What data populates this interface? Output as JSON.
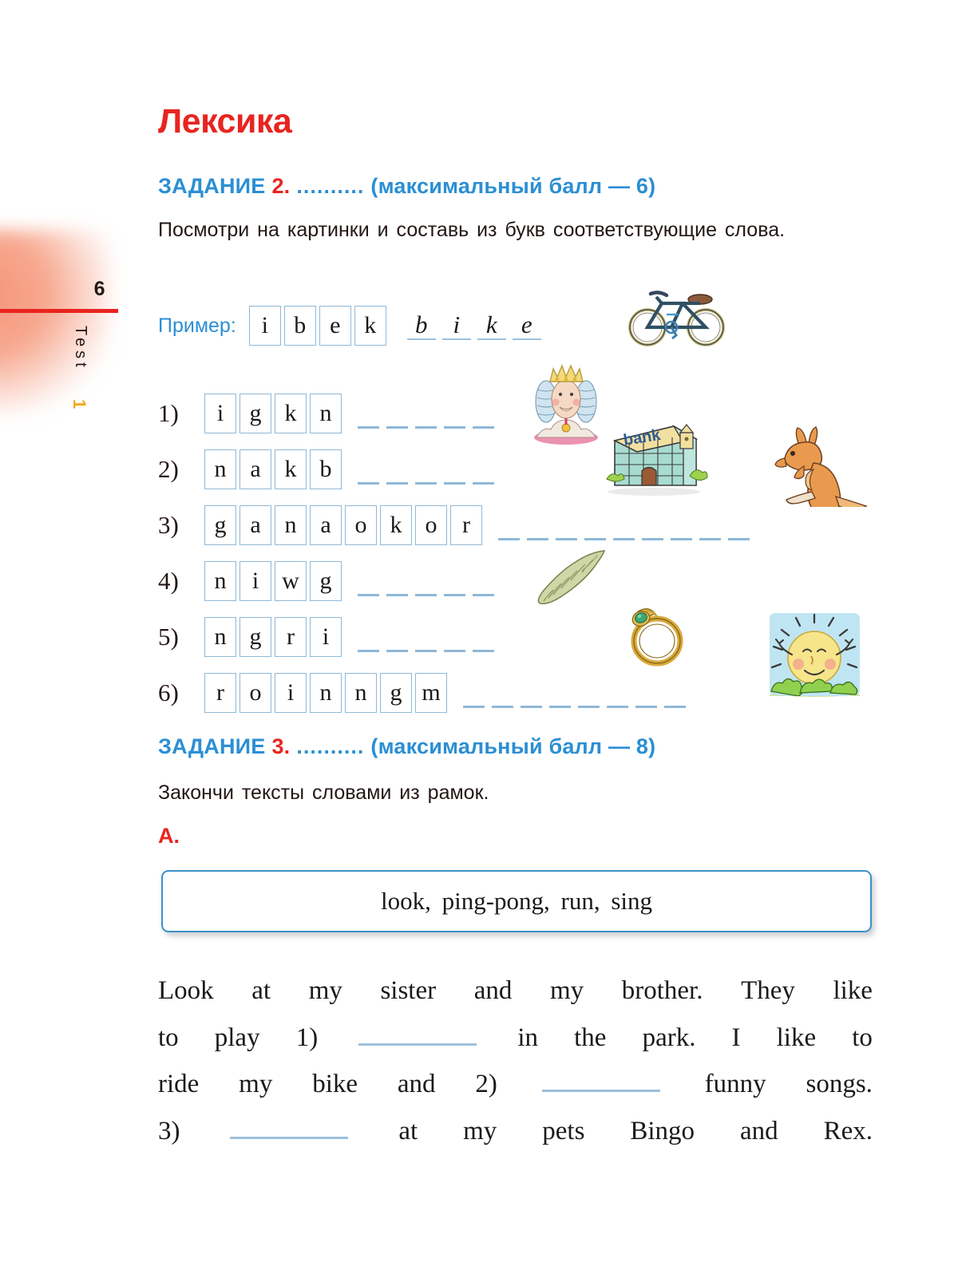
{
  "margin": {
    "page_number": "6",
    "test_label": "Test",
    "test_number": "1",
    "rule_color": "#e8241f",
    "accent_color": "#f2a922"
  },
  "section": {
    "title": "Лексика",
    "title_color": "#e8241f"
  },
  "task2": {
    "label": "ЗАДАНИЕ",
    "number": "2.",
    "dots": "..........",
    "score": "(максимальный балл — 6)",
    "label_color": "#2b8fd4",
    "number_color": "#e8241f",
    "instruction": "Посмотри на картинки и составь из букв соответствующие слова.",
    "example_label": "Пример:",
    "example_letters": [
      "i",
      "b",
      "e",
      "k"
    ],
    "example_answer": [
      "b",
      "i",
      "k",
      "e"
    ],
    "rows": [
      {
        "num": "1)",
        "letters": [
          "i",
          "g",
          "k",
          "n"
        ],
        "dashes": 5,
        "picture": "king-picture"
      },
      {
        "num": "2)",
        "letters": [
          "n",
          "a",
          "k",
          "b"
        ],
        "dashes": 5,
        "picture": "bank-picture"
      },
      {
        "num": "3)",
        "letters": [
          "g",
          "a",
          "n",
          "a",
          "o",
          "k",
          "o",
          "r"
        ],
        "dashes": 9,
        "picture": "kangaroo-picture"
      },
      {
        "num": "4)",
        "letters": [
          "n",
          "i",
          "w",
          "g"
        ],
        "dashes": 5,
        "picture": "wing-picture"
      },
      {
        "num": "5)",
        "letters": [
          "n",
          "g",
          "r",
          "i"
        ],
        "dashes": 5,
        "picture": "ring-picture"
      },
      {
        "num": "6)",
        "letters": [
          "r",
          "o",
          "i",
          "n",
          "n",
          "g",
          "m"
        ],
        "dashes": 8,
        "picture": "morning-sun-picture"
      }
    ]
  },
  "task3": {
    "label": "ЗАДАНИЕ",
    "number": "3.",
    "dots": "..........",
    "score": "(максимальный балл — 8)",
    "instruction": "Закончи тексты словами из рамок.",
    "part_letter": "А.",
    "word_bank": "look,  ping-pong,  run,  sing",
    "text_lines": [
      [
        "Look",
        "at",
        "my",
        "sister",
        "and",
        "my",
        "brother.",
        "They",
        "like"
      ],
      [
        "to",
        "play",
        "1)",
        "BLANK",
        "in",
        "the",
        "park.",
        "I",
        "like",
        "to"
      ],
      [
        "ride",
        "my",
        "bike",
        "and",
        "2)",
        "BLANK",
        "funny",
        "songs."
      ],
      [
        "3)",
        "BLANK",
        "at",
        "my",
        "pets",
        "Bingo",
        "and",
        "Rex."
      ]
    ]
  },
  "colors": {
    "box_border": "#8fb8d8",
    "dash": "#8fb8d8",
    "bank_border": "#3a92c8"
  }
}
